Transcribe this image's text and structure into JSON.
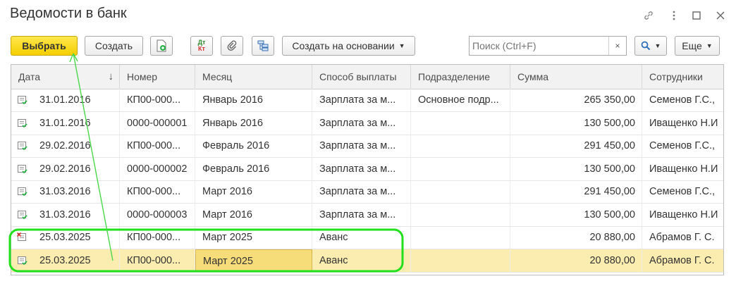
{
  "window": {
    "title": "Ведомости в банк"
  },
  "toolbar": {
    "select_label": "Выбрать",
    "create_label": "Создать",
    "dt_kt_label_top": "Дт",
    "dt_kt_label_bottom": "Кт",
    "create_based_label": "Создать на основании",
    "more_label": "Еще",
    "search_placeholder": "Поиск (Ctrl+F)",
    "clear_label": "×"
  },
  "table": {
    "columns": [
      "Дата",
      "Номер",
      "Месяц",
      "Способ выплаты",
      "Подразделение",
      "Сумма",
      "Сотрудники"
    ],
    "sort_indicator": "↓",
    "rows": [
      {
        "date": "31.01.2016",
        "number": "КП00-000...",
        "month": "Январь 2016",
        "method": "Зарплата за м...",
        "dept": "Основное подр...",
        "sum": "265 350,00",
        "employees": "Семенов Г.С.,",
        "status": "posted"
      },
      {
        "date": "31.01.2016",
        "number": "0000-000001",
        "month": "Январь 2016",
        "method": "Зарплата за м...",
        "dept": "",
        "sum": "130 500,00",
        "employees": "Иващенко Н.И",
        "status": "posted"
      },
      {
        "date": "29.02.2016",
        "number": "КП00-000...",
        "month": "Февраль 2016",
        "method": "Зарплата за м...",
        "dept": "",
        "sum": "291 450,00",
        "employees": "Семенов Г.С.,",
        "status": "posted"
      },
      {
        "date": "29.02.2016",
        "number": "0000-000002",
        "month": "Февраль 2016",
        "method": "Зарплата за м...",
        "dept": "",
        "sum": "130 500,00",
        "employees": "Иващенко Н.И",
        "status": "posted"
      },
      {
        "date": "31.03.2016",
        "number": "КП00-000...",
        "month": "Март 2016",
        "method": "Зарплата за м...",
        "dept": "",
        "sum": "291 450,00",
        "employees": "Семенов Г.С.,",
        "status": "posted"
      },
      {
        "date": "31.03.2016",
        "number": "0000-000003",
        "month": "Март 2016",
        "method": "Зарплата за м...",
        "dept": "",
        "sum": "130 500,00",
        "employees": "Иващенко Н.И",
        "status": "posted"
      },
      {
        "date": "25.03.2025",
        "number": "КП00-000...",
        "month": "Март 2025",
        "method": "Аванс",
        "dept": "",
        "sum": "20 880,00",
        "employees": "Абрамов Г. С.",
        "status": "deleted"
      },
      {
        "date": "25.03.2025",
        "number": "КП00-000...",
        "month": "Март 2025",
        "method": "Аванс",
        "dept": "",
        "sum": "20 880,00",
        "employees": "Абрамов Г. С.",
        "status": "posted"
      }
    ]
  },
  "colors": {
    "accent_yellow": "#f5cf00",
    "selected_row": "#fbecb0",
    "highlight_green": "#22e01b",
    "icon_green": "#2bb34a",
    "icon_red": "#d32f2f"
  }
}
